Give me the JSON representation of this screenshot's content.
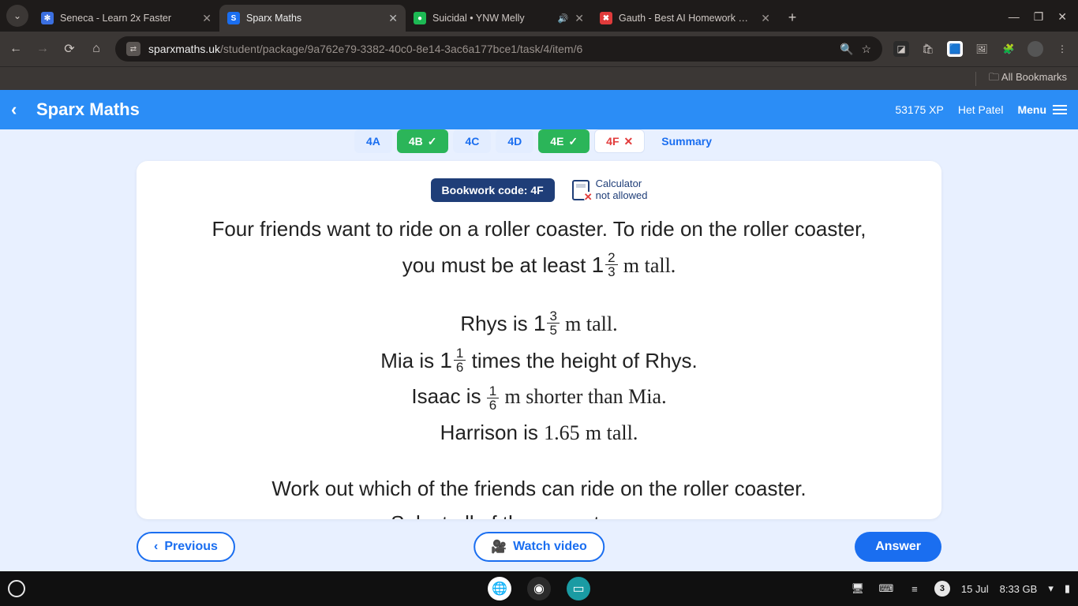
{
  "browser": {
    "tabs": [
      {
        "title": "Seneca - Learn 2x Faster",
        "fav_bg": "#3b6fe0",
        "fav_text": "✻"
      },
      {
        "title": "Sparx Maths",
        "fav_bg": "#1a6ef0",
        "fav_text": "S"
      },
      {
        "title": "Suicidal • YNW Melly",
        "fav_bg": "#1db954",
        "fav_text": "●",
        "audio": true
      },
      {
        "title": "Gauth - Best AI Homework Help",
        "fav_bg": "#e03b3b",
        "fav_text": "✖"
      }
    ],
    "url_domain": "sparxmaths.uk",
    "url_path": "/student/package/9a762e79-3382-40c0-8e14-3ac6a177bce1/task/4/item/6",
    "bookmarks_label": "All Bookmarks"
  },
  "sparx": {
    "brand": "Sparx Maths",
    "xp": "53175 XP",
    "user": "Het Patel",
    "menu": "Menu",
    "tasks": [
      {
        "label": "4A",
        "state": "idle"
      },
      {
        "label": "4B",
        "state": "done"
      },
      {
        "label": "4C",
        "state": "idle"
      },
      {
        "label": "4D",
        "state": "idle"
      },
      {
        "label": "4E",
        "state": "done"
      },
      {
        "label": "4F",
        "state": "wrong"
      }
    ],
    "summary": "Summary",
    "bookwork": "Bookwork code: 4F",
    "calc_l1": "Calculator",
    "calc_l2": "not allowed",
    "q": {
      "intro_a": "Four friends want to ride on a roller coaster. To ride on the roller coaster,",
      "intro_b_pre": "you must be at least ",
      "req_whole": "1",
      "req_num": "2",
      "req_den": "3",
      "intro_b_post": " m tall.",
      "rhys_pre": "Rhys is ",
      "rhys_whole": "1",
      "rhys_num": "3",
      "rhys_den": "5",
      "rhys_post": " m tall.",
      "mia_pre": "Mia is ",
      "mia_whole": "1",
      "mia_num": "1",
      "mia_den": "6",
      "mia_post": " times the height of Rhys.",
      "isaac_pre": "Isaac is ",
      "isaac_num": "1",
      "isaac_den": "6",
      "isaac_post": " m shorter than Mia.",
      "harrison_pre": "Harrison is ",
      "harrison_val": "1.65",
      "harrison_post": " m tall.",
      "task_a": "Work out which of the friends can ride on the roller coaster.",
      "task_b": "Select all of the correct answers."
    },
    "btn_prev": "Previous",
    "btn_watch": "Watch video",
    "btn_answer": "Answer"
  },
  "shelf": {
    "notif_count": "3",
    "date": "15 Jul",
    "status": "8:33 GB"
  }
}
